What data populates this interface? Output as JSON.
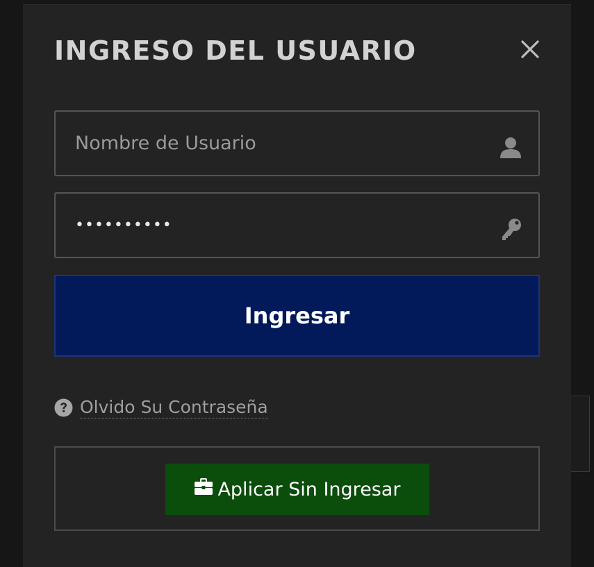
{
  "modal": {
    "title": "INGRESO DEL USUARIO",
    "close_icon": "close-icon"
  },
  "form": {
    "username": {
      "placeholder": "Nombre de Usuario",
      "value": "",
      "icon": "user-icon"
    },
    "password": {
      "value": "••••••••••",
      "icon": "key-icon"
    },
    "submit_label": "Ingresar",
    "forgot_password": {
      "label": "Olvido Su Contraseña",
      "icon": "question-circle-icon"
    },
    "apply_without_login": {
      "label": "Aplicar Sin Ingresar",
      "icon": "briefcase-icon"
    }
  },
  "colors": {
    "background": "#161616",
    "modal_bg": "#232323",
    "primary_button": "#02195a",
    "apply_button": "#0b4d0b",
    "title_text": "#d2d2d2",
    "muted_text": "#9f9f9f"
  }
}
